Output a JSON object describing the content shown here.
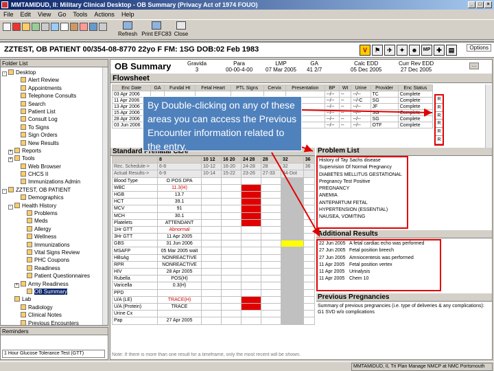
{
  "window": {
    "title": "MMTAMIDUD, II: Military Clinical Desktop - OB Summary (Privacy Act of 1974 FOUO)",
    "minimize": "_",
    "maximize": "□",
    "close": "×"
  },
  "menu": [
    "File",
    "Edit",
    "View",
    "Go",
    "Tools",
    "Actions",
    "Help"
  ],
  "toolbar": {
    "refresh": "Refresh",
    "print": "Print EFC83",
    "close": "Close"
  },
  "patient": {
    "banner": "ZZTEST, OB PATIENT 00/354-08-8770 22yo F FM: 1SG DOB:02 Feb 1983",
    "options": "Options"
  },
  "folder": {
    "header": "Folder List",
    "items": [
      {
        "label": "Desktop",
        "indent": 0,
        "pm": "-"
      },
      {
        "label": "Alert Review",
        "indent": 2
      },
      {
        "label": "Appointments",
        "indent": 2
      },
      {
        "label": "Telephone Consults",
        "indent": 2
      },
      {
        "label": "Search",
        "indent": 2
      },
      {
        "label": "Patient List",
        "indent": 2
      },
      {
        "label": "Consult Log",
        "indent": 2
      },
      {
        "label": "To Signs",
        "indent": 2
      },
      {
        "label": "Sign Orders",
        "indent": 2
      },
      {
        "label": "New Results",
        "indent": 2
      },
      {
        "label": "Reports",
        "indent": 1,
        "pm": "+"
      },
      {
        "label": "Tools",
        "indent": 1,
        "pm": "+"
      },
      {
        "label": "Web Browser",
        "indent": 2
      },
      {
        "label": "CHCS II",
        "indent": 2
      },
      {
        "label": "Immunizations Admin",
        "indent": 2
      },
      {
        "label": "ZZTEST, OB PATIENT",
        "indent": 0,
        "pm": "-"
      },
      {
        "label": "Demographics",
        "indent": 2
      },
      {
        "label": "Health History",
        "indent": 1,
        "pm": "-"
      },
      {
        "label": "Problems",
        "indent": 3
      },
      {
        "label": "Meds",
        "indent": 3
      },
      {
        "label": "Allergy",
        "indent": 3
      },
      {
        "label": "Wellness",
        "indent": 3
      },
      {
        "label": "Immunizations",
        "indent": 3
      },
      {
        "label": "Vital Signs Review",
        "indent": 3
      },
      {
        "label": "PHC Coupons",
        "indent": 3
      },
      {
        "label": "Readiness",
        "indent": 3
      },
      {
        "label": "Patient Questionnaires",
        "indent": 3
      },
      {
        "label": "Army Readiness",
        "indent": 2,
        "pm": "+"
      },
      {
        "label": "OB Summary",
        "indent": 3,
        "sel": true
      },
      {
        "label": "Lab",
        "indent": 1
      },
      {
        "label": "Radiology",
        "indent": 2
      },
      {
        "label": "Clinical Notes",
        "indent": 2
      },
      {
        "label": "Previous Encounters",
        "indent": 2
      }
    ]
  },
  "reminders": {
    "header": "Reminders",
    "item": "1 Hour Glucose Tolerance Test (GTT)"
  },
  "ob": {
    "title": "OB Summary",
    "stats": [
      {
        "label": "Gravida",
        "value": "3"
      },
      {
        "label": "Para",
        "value": "00-00-4-00"
      },
      {
        "label": "LMP",
        "value": "07 Mar 2005"
      },
      {
        "label": "GA",
        "value": "41 2/7"
      },
      {
        "label": "Calc EDD",
        "value": "05 Dec 2005"
      },
      {
        "label": "Curr Rev EDD",
        "value": "27 Dec 2005"
      }
    ]
  },
  "flowsheet": {
    "title": "Flowsheet",
    "headers": [
      "Enc Date",
      "GA",
      "Fundal Ht",
      "Fetal Heart",
      "PTL Signs",
      "Cervix",
      "Presentation",
      "BP",
      "Wt",
      "Urine",
      "Provider",
      "Enc Status"
    ],
    "rows": [
      [
        "03 Apr 2006",
        "",
        "",
        "",
        "",
        "",
        "",
        "--/--",
        "--",
        "--/--",
        "TC",
        "Complete"
      ],
      [
        "11 Apr 2006",
        "",
        "",
        "",
        "",
        "",
        "",
        "--/--",
        "--",
        "--/-C",
        "SG",
        "Complete"
      ],
      [
        "13 Apr 2006",
        "",
        "",
        "",
        "",
        "",
        "",
        "--/--",
        "--",
        "--/--",
        "JF",
        "Complete"
      ],
      [
        "15 Apr 2006",
        "",
        "",
        "",
        "",
        "",
        "",
        "--/--",
        "--",
        "--/--",
        "SG",
        "Complete"
      ],
      [
        "28 Apr 2006",
        "",
        "",
        "",
        "",
        "",
        "",
        "--/--",
        "--",
        "--/--",
        "SG",
        "Complete"
      ],
      [
        "03 Jun 2006",
        "",
        "",
        "",
        "",
        "",
        "",
        "--/--",
        "--",
        "--/--",
        "OTF",
        "Complete"
      ]
    ],
    "side_tabs": [
      "R",
      "R",
      "R",
      "R",
      "R",
      "R"
    ]
  },
  "callout": "By Double-clicking on any of these areas you can access the Previous Encounter information related to the entry.",
  "standard": {
    "title": "Standard Prenatal Care",
    "cols": [
      "",
      "8",
      "10 12",
      "16 20",
      "24 28",
      "28",
      "32",
      "36"
    ],
    "sched_row": [
      "Rec. Schedule->",
      "6-8",
      "10-12",
      "16-20",
      "24-28",
      "28",
      "32",
      "36"
    ],
    "actual_row": [
      "Actual Results->",
      "6-9",
      "10-14",
      "15-22",
      "23-26",
      "27-33",
      "34-Dot",
      ""
    ],
    "rows": [
      {
        "label": "Blood Type",
        "v": "O POS DPA",
        "marks": [
          0,
          0,
          0,
          0,
          0
        ]
      },
      {
        "label": "WBC",
        "v": "11.3(H)",
        "red": true,
        "marks": [
          0,
          0,
          1,
          0,
          0
        ]
      },
      {
        "label": "HGB",
        "v": "13.7",
        "marks": [
          0,
          0,
          1,
          0,
          0
        ]
      },
      {
        "label": "HCT",
        "v": "39.1",
        "marks": [
          0,
          0,
          1,
          0,
          0
        ]
      },
      {
        "label": "MCV",
        "v": "91",
        "marks": [
          0,
          0,
          1,
          0,
          0
        ]
      },
      {
        "label": "MCH",
        "v": "30.1",
        "marks": [
          0,
          0,
          1,
          0,
          0
        ]
      },
      {
        "label": "Platelets",
        "v": "ATTENDANT",
        "marks": [
          0,
          0,
          1,
          0,
          0
        ]
      },
      {
        "label": "1Hr GTT",
        "v": "Abnormal",
        "red": true,
        "marks": [
          0,
          0,
          0,
          0,
          0
        ]
      },
      {
        "label": "3Hr GTT",
        "v": "11 Apr 2005",
        "marks": [
          0,
          0,
          0,
          0,
          0
        ]
      },
      {
        "label": "GBS",
        "v": "31 Jun 2006",
        "marks": [
          0,
          0,
          0,
          0,
          2
        ]
      },
      {
        "label": "MSAFP",
        "v": "05 Mar 2005 wait",
        "marks": [
          0,
          0,
          0,
          0,
          0
        ]
      },
      {
        "label": "HBsAg",
        "v": "NONREACTIVE",
        "marks": [
          0,
          0,
          0,
          0,
          0
        ]
      },
      {
        "label": "RPR",
        "v": "NONREACTIVE",
        "marks": [
          0,
          0,
          0,
          0,
          0
        ]
      },
      {
        "label": "HIV",
        "v": "28 Apr 2005",
        "marks": [
          0,
          0,
          0,
          0,
          0
        ]
      },
      {
        "label": "Rubella",
        "v": "POS(H)",
        "marks": [
          0,
          0,
          0,
          0,
          0
        ]
      },
      {
        "label": "Varicella",
        "v": "0.3(H)",
        "marks": [
          0,
          0,
          0,
          0,
          0
        ]
      },
      {
        "label": "PPD",
        "v": "",
        "marks": [
          0,
          0,
          0,
          0,
          0
        ]
      },
      {
        "label": "U/A (LE)",
        "v": "TRACE(H)",
        "red": true,
        "marks": [
          0,
          0,
          1,
          0,
          0
        ]
      },
      {
        "label": "U/A (Protein)",
        "v": "TRACE",
        "marks": [
          0,
          0,
          1,
          0,
          0
        ]
      },
      {
        "label": "Urine Cx",
        "v": "",
        "marks": [
          0,
          0,
          0,
          0,
          0
        ]
      },
      {
        "label": "Pap",
        "v": "27 Apr 2005",
        "marks": [
          0,
          0,
          0,
          0,
          0
        ]
      }
    ],
    "footnote": "Note: If there is more than one result for a timeframe, only the most recent will be shown."
  },
  "problems": {
    "title": "Problem List",
    "items": [
      "History of Tay Sachs disease",
      "Supervision Of Normal Pregnancy",
      "DIABETES MELLITUS GESTATIONAL",
      "Pregnancy Test Positive",
      "PREGNANCY",
      "ANEMIA",
      "ANTEPARTUM FETAL",
      "HYPERTENSION (ESSENTIAL)",
      "NAUSEA, VOMITING"
    ]
  },
  "results": {
    "title": "Additional Results",
    "items": [
      [
        "22 Jun 2005",
        "A fetal cardiac echo was performed"
      ],
      [
        "27 Jun 2005",
        "Fetal position breech"
      ],
      [
        "27 Jun 2005",
        "Amniocentesis was performed"
      ],
      [
        "11 Apr 2005",
        "Fetal position vertex"
      ],
      [
        "11 Apr 2005",
        "Urinalysis"
      ],
      [
        "11 Apr 2005",
        "Chem 10"
      ]
    ]
  },
  "previous": {
    "title": "Previous Pregnancies",
    "text": "Summary of previous pregnancies (i.e. type of deliveries & any complications): G1 SVD w/o complications"
  },
  "status": {
    "left": "",
    "right": "MMTAMIDUD, II, Tri Plan Manage NMCP at NMC Portsmouth"
  }
}
